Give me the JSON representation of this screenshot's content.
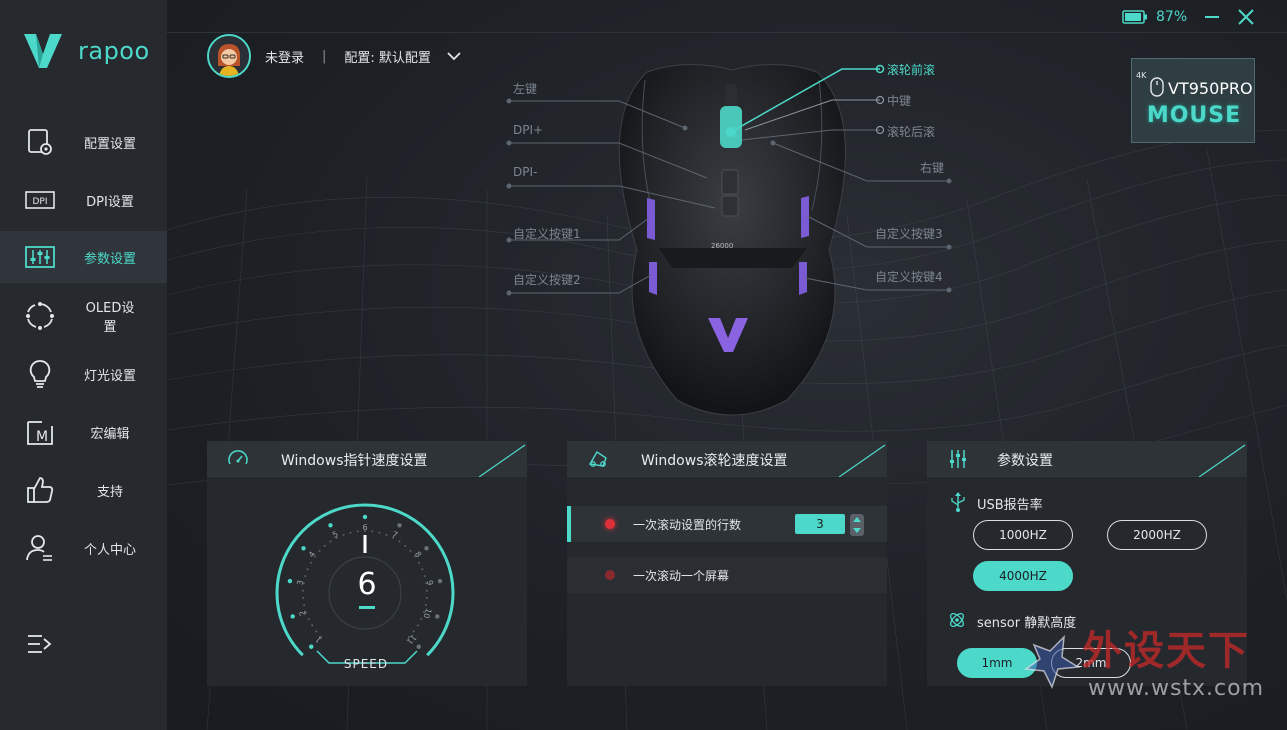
{
  "app": {
    "brand": "rapoo"
  },
  "sidebar": {
    "items": [
      {
        "label": "配置设置",
        "icon": "profile-settings-icon"
      },
      {
        "label": "DPI设置",
        "icon": "dpi-icon",
        "icon_text": "DPI"
      },
      {
        "label": "参数设置",
        "icon": "sliders-icon",
        "active": true
      },
      {
        "label": "OLED设置",
        "icon": "oled-icon"
      },
      {
        "label": "灯光设置",
        "icon": "bulb-icon"
      },
      {
        "label": "宏编辑",
        "icon": "macro-icon",
        "icon_text": "M"
      },
      {
        "label": "支持",
        "icon": "thumbs-up-icon"
      },
      {
        "label": "个人中心",
        "icon": "user-center-icon"
      }
    ]
  },
  "topbar": {
    "battery": "87%",
    "user_name": "未登录",
    "separator": "|",
    "config_label": "配置: 默认配置"
  },
  "device": {
    "badge": "4K",
    "model": "VT950PRO",
    "type": "MOUSE"
  },
  "mouse_callouts": {
    "left_button": "左键",
    "dpi_plus": "DPI+",
    "dpi_minus": "DPI-",
    "custom1": "自定义按键1",
    "custom2": "自定义按键2",
    "scroll_up": "滚轮前滚",
    "middle": "中键",
    "scroll_down": "滚轮后滚",
    "right_button": "右键",
    "custom3": "自定义按键3",
    "custom4": "自定义按键4",
    "mouse_dpi_text": "26000"
  },
  "pointer_panel": {
    "title": "Windows指针速度设置",
    "value": "6",
    "level": 6,
    "max": 11,
    "ticks": [
      "1",
      "2",
      "3",
      "4",
      "5",
      "6",
      "7",
      "8",
      "9",
      "10",
      "11"
    ],
    "label": "SPEED"
  },
  "scroll_panel": {
    "title": "Windows滚轮速度设置",
    "row1": "一次滚动设置的行数",
    "row1_value": "3",
    "row2": "一次滚动一个屏幕"
  },
  "param_panel": {
    "title": "参数设置",
    "usb_title": "USB报告率",
    "usb_options": [
      "1000HZ",
      "2000HZ",
      "4000HZ"
    ],
    "usb_selected": "4000HZ",
    "sensor_title": "sensor 静默高度",
    "sensor_options": [
      "1mm",
      "2mm"
    ],
    "sensor_selected": "1mm"
  },
  "watermark": {
    "text": "外设天下",
    "url": "www.wstx.com"
  },
  "colors": {
    "accent": "#4dd9c9",
    "sidebar_bg": "#26292e",
    "panel_bg": "#25292e",
    "active_dot": "#e0303a",
    "inactive_dot": "#8a2a2f"
  }
}
